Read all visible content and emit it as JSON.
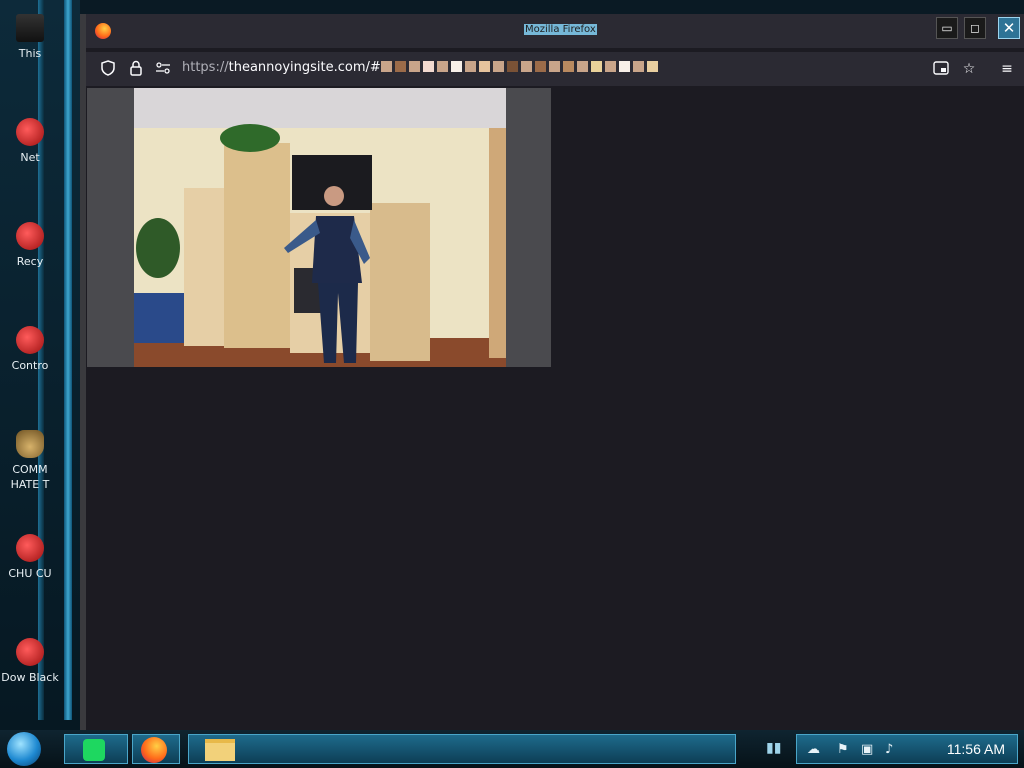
{
  "desktop": {
    "icons": [
      {
        "label": "This",
        "icon": "computer-icon"
      },
      {
        "label": "Net",
        "icon": "network-icon"
      },
      {
        "label": "Recy",
        "icon": "recycle-bin-icon"
      },
      {
        "label": "Contro",
        "icon": "control-panel-icon"
      },
      {
        "label": "COMM HATE T",
        "icon": "money-bag-icon"
      },
      {
        "label": "CHU CU",
        "icon": "shortcut-icon"
      },
      {
        "label": "Dow Black",
        "icon": "download-icon"
      }
    ]
  },
  "window": {
    "title": "Mozilla Firefox",
    "controls": {
      "minimize": "▭",
      "maximize": "◻",
      "close": "✕"
    }
  },
  "navbar": {
    "url_protocol": "https://",
    "url_host": "theannoyingsite.com/#",
    "url_swatches": [
      "#c9a58a",
      "#9b6b49",
      "#c9a58a",
      "#f2d9cf",
      "#c9a58a",
      "#f7efe8",
      "#c9a58a",
      "#e6c39d",
      "#c9a58a",
      "#7a5236",
      "#c9a58a",
      "#9b6b49",
      "#c9a58a",
      "#b98a60",
      "#c9a58a",
      "#e9d29a",
      "#c9a58a",
      "#f7efe8",
      "#c9a58a",
      "#e9cfa0"
    ]
  },
  "content": {
    "video": "dancing man in living room"
  },
  "taskbar": {
    "clock": "11:56 AM",
    "apps": [
      "spotify-icon",
      "firefox-icon",
      "file-explorer-icon"
    ]
  }
}
